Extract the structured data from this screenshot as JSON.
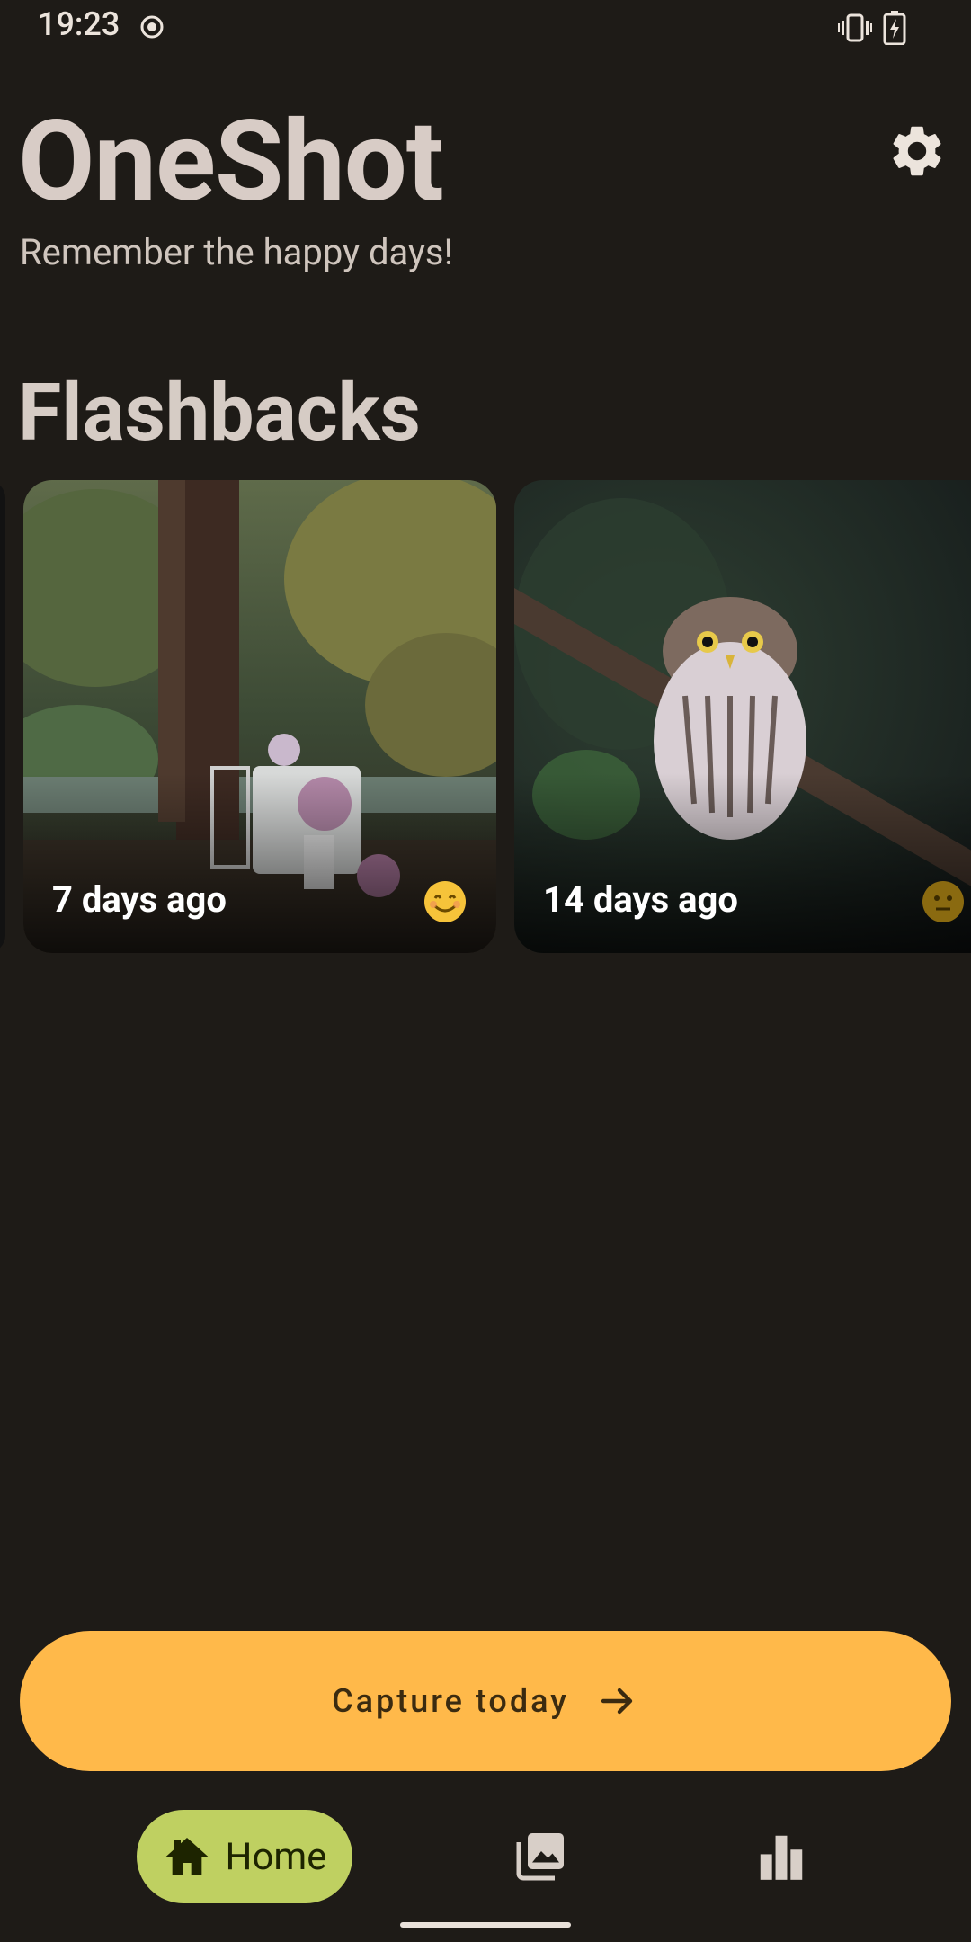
{
  "status_bar": {
    "time": "19:23",
    "icons": [
      "record-icon",
      "vibrate-icon",
      "battery-charging-icon"
    ]
  },
  "header": {
    "title": "OneShot",
    "tagline": "Remember the happy days!",
    "settings_icon": "gear-icon"
  },
  "flashbacks": {
    "title": "Flashbacks",
    "cards": [
      {
        "label": "7 days ago",
        "mood": "happy-face-icon",
        "mood_color": "#f6c33a",
        "photo": "garden-table-photo"
      },
      {
        "label": "14 days ago",
        "mood": "neutral-face-icon",
        "mood_color": "#8a6a10",
        "photo": "owl-photo"
      }
    ]
  },
  "capture": {
    "label": "Capture today",
    "icon": "arrow-right-icon"
  },
  "nav": {
    "home_label": "Home",
    "items": [
      "home-icon",
      "gallery-icon",
      "stats-icon"
    ]
  },
  "colors": {
    "background": "#1e1b17",
    "accent": "#ffb94a",
    "nav_active": "#bfd061"
  }
}
